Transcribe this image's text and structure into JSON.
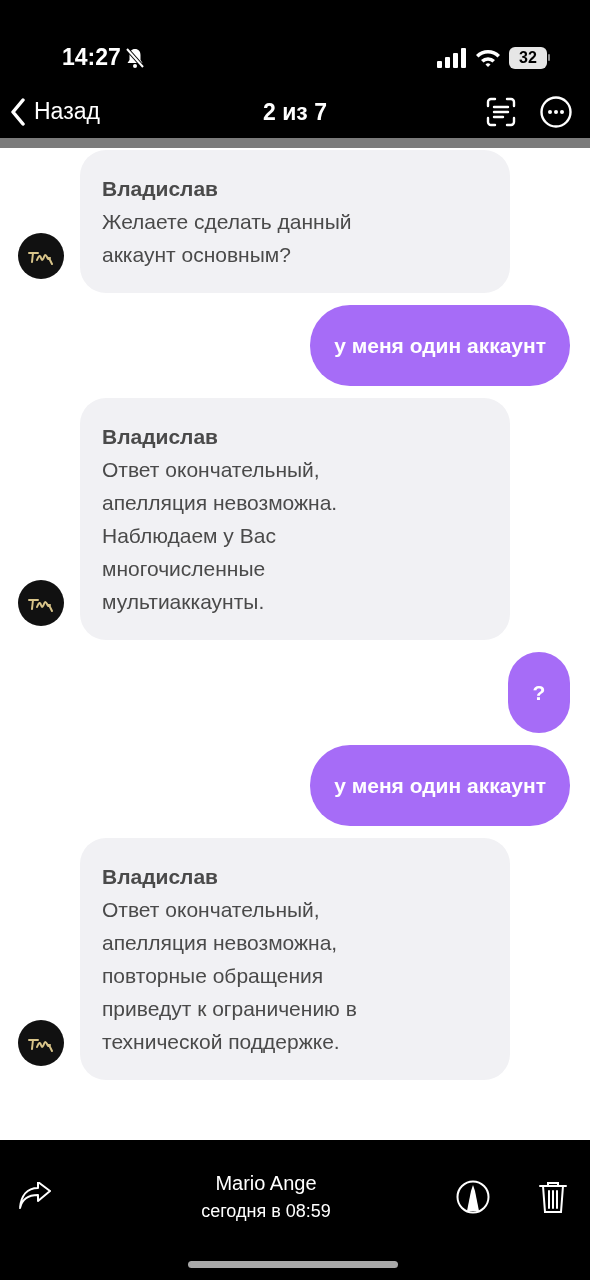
{
  "status_bar": {
    "time": "14:27",
    "silent": true,
    "battery": "32"
  },
  "nav": {
    "back": "Назад",
    "title": "2 из 7"
  },
  "messages": [
    {
      "kind": "incoming",
      "sender": "Владислав",
      "text": "Желаете сделать данный\nаккаунт основным?"
    },
    {
      "kind": "outgoing",
      "text": "у меня один аккаунт"
    },
    {
      "kind": "incoming",
      "sender": "Владислав",
      "text": "Ответ окончательный,\nапелляция невозможна.\nНаблюдаем у Вас\nмногочисленные\nмультиаккаунты."
    },
    {
      "kind": "outgoing",
      "text": "?"
    },
    {
      "kind": "outgoing",
      "text": "у меня один аккаунт"
    },
    {
      "kind": "incoming",
      "sender": "Владислав",
      "text": "Ответ окончательный,\nапелляция невозможна,\nповторные обращения\nприведут к ограничению в\nтехнической поддержке."
    }
  ],
  "footer": {
    "name": "Mario Ange",
    "date": "сегодня в 08:59"
  }
}
